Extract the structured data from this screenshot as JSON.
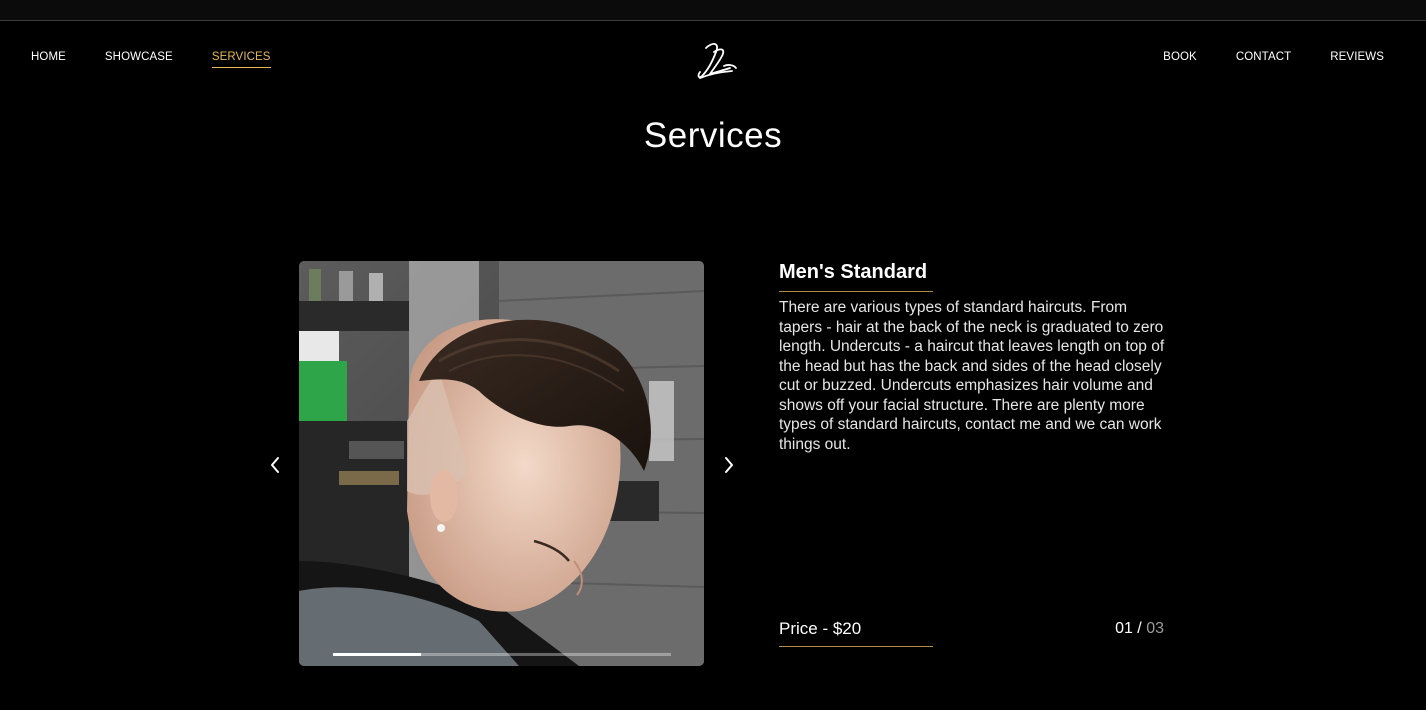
{
  "nav": {
    "left": [
      {
        "label": "HOME",
        "active": false
      },
      {
        "label": "SHOWCASE",
        "active": false
      },
      {
        "label": "SERVICES",
        "active": true
      }
    ],
    "right": [
      {
        "label": "BOOK"
      },
      {
        "label": "CONTACT"
      },
      {
        "label": "REVIEWS"
      }
    ]
  },
  "logo": {
    "icon": "script-logo-icon",
    "text": "JZ"
  },
  "page": {
    "title": "Services"
  },
  "carousel": {
    "prev_icon": "chevron-left-icon",
    "next_icon": "chevron-right-icon",
    "progress": 0.26
  },
  "service": {
    "title": "Men's Standard",
    "description": "There are various types of standard haircuts. From tapers - hair at the back of the neck is graduated to zero length. Undercuts - a haircut that leaves length on top of the head but has the back and sides of the head closely cut or buzzed. Undercuts emphasizes hair volume and shows off your facial structure. There are plenty more types of standard haircuts, contact me and we can work things out.",
    "price": "Price - $20",
    "counter": {
      "current": "01",
      "separator": " / ",
      "total": "03"
    }
  },
  "colors": {
    "background": "#000000",
    "accent": "#e6b85a",
    "rule": "#b08d45",
    "muted": "#9b9b9b"
  }
}
